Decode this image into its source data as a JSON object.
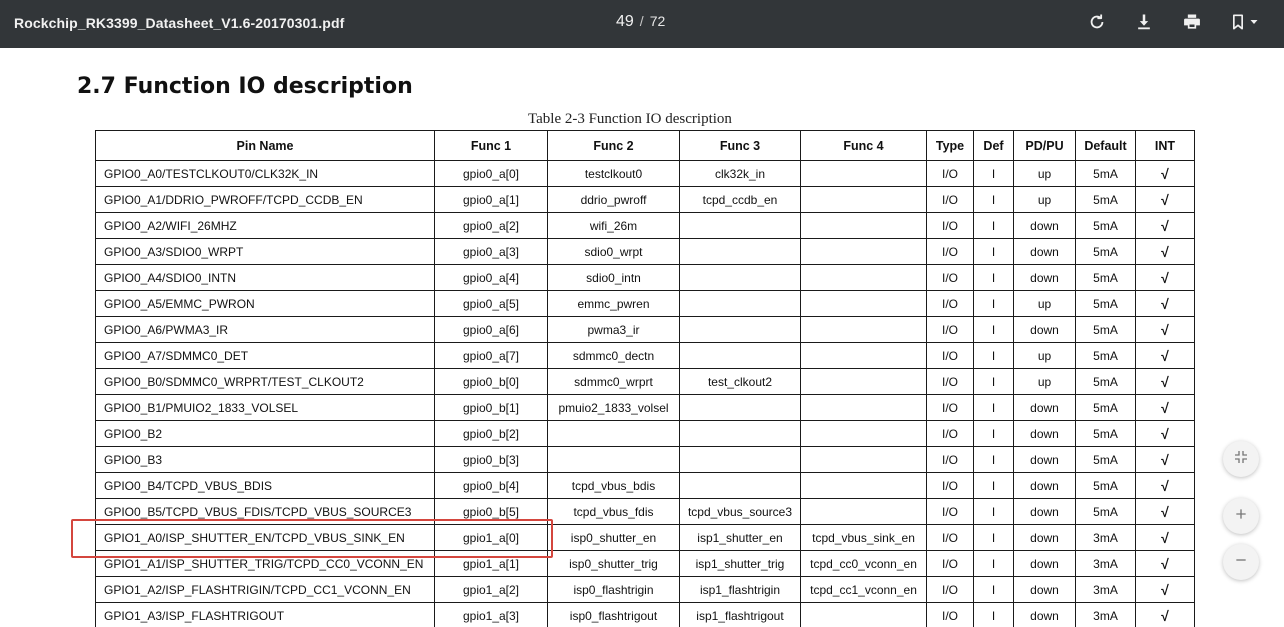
{
  "toolbar": {
    "file_title": "Rockchip_RK3399_Datasheet_V1.6-20170301.pdf",
    "current_page": "49",
    "page_separator": "/",
    "total_pages": "72",
    "icons": [
      "rotate-icon",
      "download-icon",
      "print-icon",
      "bookmark-icon",
      "chevron-down-icon"
    ]
  },
  "document": {
    "section_heading": "2.7 Function IO description",
    "table_caption": "Table 2-3 Function IO description",
    "columns": [
      "Pin Name",
      "Func 1",
      "Func 2",
      "Func 3",
      "Func 4",
      "Type",
      "Def",
      "PD/PU",
      "Default",
      "INT"
    ],
    "rows": [
      [
        "GPIO0_A0/TESTCLKOUT0/CLK32K_IN",
        "gpio0_a[0]",
        "testclkout0",
        "clk32k_in",
        "",
        "I/O",
        "I",
        "up",
        "5mA",
        "√"
      ],
      [
        "GPIO0_A1/DDRIO_PWROFF/TCPD_CCDB_EN",
        "gpio0_a[1]",
        "ddrio_pwroff",
        "tcpd_ccdb_en",
        "",
        "I/O",
        "I",
        "up",
        "5mA",
        "√"
      ],
      [
        "GPIO0_A2/WIFI_26MHZ",
        "gpio0_a[2]",
        "wifi_26m",
        "",
        "",
        "I/O",
        "I",
        "down",
        "5mA",
        "√"
      ],
      [
        "GPIO0_A3/SDIO0_WRPT",
        "gpio0_a[3]",
        "sdio0_wrpt",
        "",
        "",
        "I/O",
        "I",
        "down",
        "5mA",
        "√"
      ],
      [
        "GPIO0_A4/SDIO0_INTN",
        "gpio0_a[4]",
        "sdio0_intn",
        "",
        "",
        "I/O",
        "I",
        "down",
        "5mA",
        "√"
      ],
      [
        "GPIO0_A5/EMMC_PWRON",
        "gpio0_a[5]",
        "emmc_pwren",
        "",
        "",
        "I/O",
        "I",
        "up",
        "5mA",
        "√"
      ],
      [
        "GPIO0_A6/PWMA3_IR",
        "gpio0_a[6]",
        "pwma3_ir",
        "",
        "",
        "I/O",
        "I",
        "down",
        "5mA",
        "√"
      ],
      [
        "GPIO0_A7/SDMMC0_DET",
        "gpio0_a[7]",
        "sdmmc0_dectn",
        "",
        "",
        "I/O",
        "I",
        "up",
        "5mA",
        "√"
      ],
      [
        "GPIO0_B0/SDMMC0_WRPRT/TEST_CLKOUT2",
        "gpio0_b[0]",
        "sdmmc0_wrprt",
        "test_clkout2",
        "",
        "I/O",
        "I",
        "up",
        "5mA",
        "√"
      ],
      [
        "GPIO0_B1/PMUIO2_1833_VOLSEL",
        "gpio0_b[1]",
        "pmuio2_1833_volsel",
        "",
        "",
        "I/O",
        "I",
        "down",
        "5mA",
        "√"
      ],
      [
        "GPIO0_B2",
        "gpio0_b[2]",
        "",
        "",
        "",
        "I/O",
        "I",
        "down",
        "5mA",
        "√"
      ],
      [
        "GPIO0_B3",
        "gpio0_b[3]",
        "",
        "",
        "",
        "I/O",
        "I",
        "down",
        "5mA",
        "√"
      ],
      [
        "GPIO0_B4/TCPD_VBUS_BDIS",
        "gpio0_b[4]",
        "tcpd_vbus_bdis",
        "",
        "",
        "I/O",
        "I",
        "down",
        "5mA",
        "√"
      ],
      [
        "GPIO0_B5/TCPD_VBUS_FDIS/TCPD_VBUS_SOURCE3",
        "gpio0_b[5]",
        "tcpd_vbus_fdis",
        "tcpd_vbus_source3",
        "",
        "I/O",
        "I",
        "down",
        "5mA",
        "√"
      ],
      [
        "GPIO1_A0/ISP_SHUTTER_EN/TCPD_VBUS_SINK_EN",
        "gpio1_a[0]",
        "isp0_shutter_en",
        "isp1_shutter_en",
        "tcpd_vbus_sink_en",
        "I/O",
        "I",
        "down",
        "3mA",
        "√"
      ],
      [
        "GPIO1_A1/ISP_SHUTTER_TRIG/TCPD_CC0_VCONN_EN",
        "gpio1_a[1]",
        "isp0_shutter_trig",
        "isp1_shutter_trig",
        "tcpd_cc0_vconn_en",
        "I/O",
        "I",
        "down",
        "3mA",
        "√"
      ],
      [
        "GPIO1_A2/ISP_FLASHTRIGIN/TCPD_CC1_VCONN_EN",
        "gpio1_a[2]",
        "isp0_flashtrigin",
        "isp1_flashtrigin",
        "tcpd_cc1_vconn_en",
        "I/O",
        "I",
        "down",
        "3mA",
        "√"
      ],
      [
        "GPIO1_A3/ISP_FLASHTRIGOUT",
        "gpio1_a[3]",
        "isp0_flashtrigout",
        "isp1_flashtrigout",
        "",
        "I/O",
        "I",
        "down",
        "3mA",
        "√"
      ]
    ],
    "highlighted_row": "GPIO1_A0/ISP_SHUTTER_EN/TCPD_VBUS_SINK_EN",
    "highlight_color": "#d4463e"
  },
  "viewer_controls": {
    "icons": [
      "fit-page-icon",
      "zoom-in-icon",
      "zoom-out-icon"
    ]
  }
}
